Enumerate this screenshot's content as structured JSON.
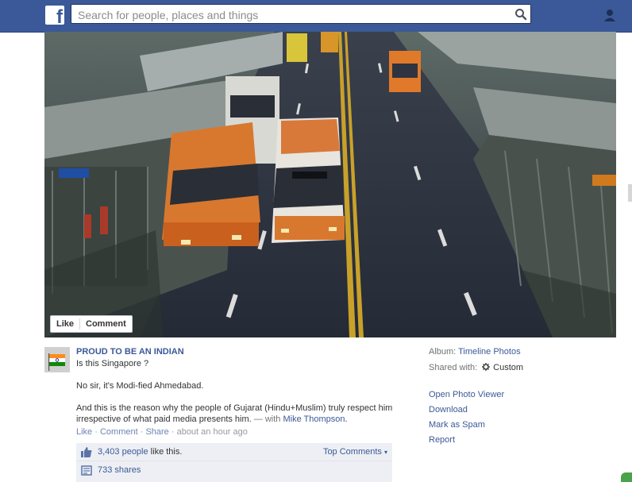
{
  "topbar": {
    "logo_letter": "f",
    "search_placeholder": "Search for people, places and things",
    "colors": {
      "bar": "#3b5998",
      "text_link": "#3b5998"
    }
  },
  "photo": {
    "actions": {
      "like": "Like",
      "comment": "Comment"
    },
    "signs": {
      "left_station": "",
      "bus_destination": ""
    }
  },
  "post": {
    "page_name": "PROUD TO BE AN INDIAN",
    "caption": "Is this Singapore ?",
    "line1": "No sir, it's Modi-fied Ahmedabad.",
    "line2a": "And this is the reason why the people of Gujarat (Hindu+Muslim) truly respect him",
    "line2b": "irrespective of what paid media presents him.",
    "with_prefix": "— with",
    "with_name": "Mike Thompson",
    "with_suffix": ".",
    "meta": {
      "like": "Like",
      "comment": "Comment",
      "share": "Share",
      "time": "about an hour ago",
      "dot": " · "
    },
    "ufi": {
      "likes_link": "3,403 people",
      "likes_suffix": " like this.",
      "top_comments": "Top Comments",
      "shares": "733 shares"
    }
  },
  "sidebar": {
    "album_label": "Album:",
    "album_value": "Timeline Photos",
    "shared_label": "Shared with:",
    "shared_value": "Custom",
    "links": [
      "Open Photo Viewer",
      "Download",
      "Mark as Spam",
      "Report"
    ]
  }
}
